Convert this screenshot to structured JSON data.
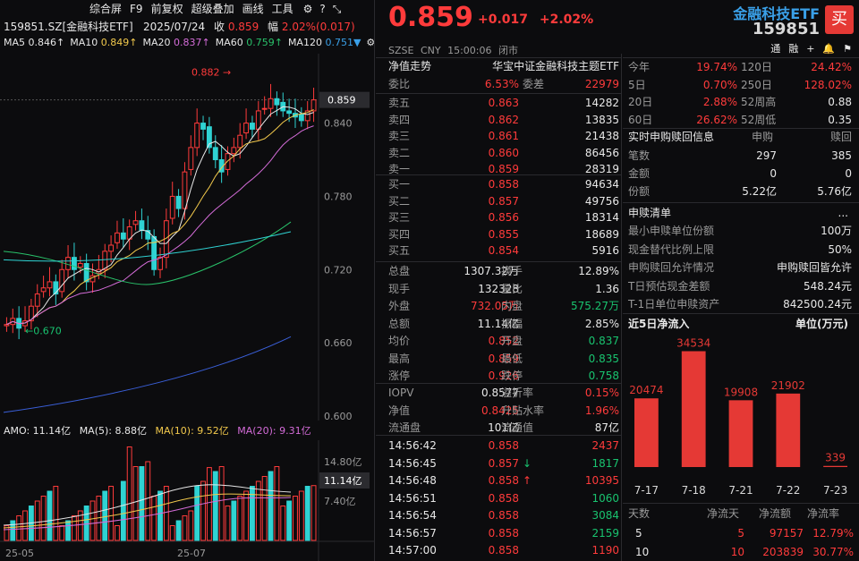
{
  "chart_header": {
    "symbol": "159851.SZ[金融科技ETF]",
    "date": "2025/07/24",
    "close_label": "收",
    "close_value": "0.859",
    "change_label": "幅",
    "change_value": "2.02%(0.017)"
  },
  "toolbar": [
    "综合屏",
    "F9",
    "前复权",
    "超级叠加",
    "画线",
    "工具"
  ],
  "ma_legend": [
    {
      "label": "MA5",
      "value": "0.846↑",
      "color": "#e8e8e8"
    },
    {
      "label": "MA10",
      "value": "0.849↑",
      "color": "#f2c94c"
    },
    {
      "label": "MA20",
      "value": "0.837↑",
      "color": "#d46cd8"
    },
    {
      "label": "MA60",
      "value": "0.759↑",
      "color": "#29c26a"
    },
    {
      "label": "MA120",
      "value": "0.751▼",
      "color": "#3aa0e8"
    }
  ],
  "price_axis": [
    "0.840",
    "0.780",
    "0.720",
    "0.660",
    "0.600"
  ],
  "current_price_tag": "0.859",
  "annotations": {
    "high": "0.882",
    "low": "0.670"
  },
  "volume_header": {
    "amo": "AMO: 11.14亿",
    "ma5": "MA(5): 8.88亿",
    "ma10": "MA(10): 9.52亿",
    "ma20": "MA(20): 9.31亿"
  },
  "volume_axis": [
    "14.80亿",
    "11.14亿",
    "7.40亿"
  ],
  "date_axis": [
    "25-05",
    "25-07"
  ],
  "quote": {
    "price": "0.859",
    "change": "+0.017",
    "change_pct": "+2.02%",
    "name": "金融科技ETF",
    "code": "159851",
    "buy_button": "买",
    "market": "SZSE",
    "currency": "CNY",
    "time": "15:00:06",
    "status": "闭市",
    "right_icons": [
      "通",
      "融",
      "+",
      "🔔",
      "⚑"
    ]
  },
  "nav": {
    "label": "净值走势",
    "fund": "华宝中证金融科技主题ETF"
  },
  "ratios": {
    "wb_label": "委比",
    "wb_value": "6.53%",
    "wc_label": "委差",
    "wc_value": "22979"
  },
  "asks": [
    {
      "label": "卖五",
      "price": "0.863",
      "vol": "14282"
    },
    {
      "label": "卖四",
      "price": "0.862",
      "vol": "13835"
    },
    {
      "label": "卖三",
      "price": "0.861",
      "vol": "21438"
    },
    {
      "label": "卖二",
      "price": "0.860",
      "vol": "86456"
    },
    {
      "label": "卖一",
      "price": "0.859",
      "vol": "28319"
    }
  ],
  "bids": [
    {
      "label": "买一",
      "price": "0.858",
      "vol": "94634"
    },
    {
      "label": "买二",
      "price": "0.857",
      "vol": "49756"
    },
    {
      "label": "买三",
      "price": "0.856",
      "vol": "18314"
    },
    {
      "label": "买四",
      "price": "0.855",
      "vol": "18689"
    },
    {
      "label": "买五",
      "price": "0.854",
      "vol": "5916"
    }
  ],
  "stats": [
    {
      "l1": "总盘",
      "v1": "1307.32万",
      "c1": "white",
      "l2": "换手",
      "v2": "12.89%",
      "c2": "white"
    },
    {
      "l1": "现手",
      "v1": "132328",
      "c1": "white",
      "l2": "量比",
      "v2": "1.36",
      "c2": "white"
    },
    {
      "l1": "外盘",
      "v1": "732.05万",
      "c1": "red",
      "l2": "内盘",
      "v2": "575.27万",
      "c2": "green"
    },
    {
      "l1": "总额",
      "v1": "11.14亿",
      "c1": "white",
      "l2": "振幅",
      "v2": "2.85%",
      "c2": "white"
    },
    {
      "l1": "均价",
      "v1": "0.852",
      "c1": "red",
      "l2": "开盘",
      "v2": "0.837",
      "c2": "green"
    },
    {
      "l1": "最高",
      "v1": "0.859",
      "c1": "red",
      "l2": "最低",
      "v2": "0.835",
      "c2": "green"
    },
    {
      "l1": "涨停",
      "v1": "0.926",
      "c1": "red",
      "l2": "跌停",
      "v2": "0.758",
      "c2": "green"
    }
  ],
  "iopv": [
    {
      "l1": "IOPV",
      "v1": "0.8577",
      "c1": "white",
      "l2": "溢折率",
      "v2": "0.15%",
      "c2": "red"
    },
    {
      "l1": "净值",
      "v1": "0.8425",
      "c1": "red",
      "l2": "升贴水率",
      "v2": "1.96%",
      "c2": "red"
    },
    {
      "l1": "流通盘",
      "v1": "101亿",
      "c1": "white",
      "l2": "流通值",
      "v2": "87亿",
      "c2": "white"
    }
  ],
  "ticks": [
    {
      "time": "14:56:42",
      "price": "0.858",
      "arrow": "",
      "vol": "2437",
      "vc": "red"
    },
    {
      "time": "14:56:45",
      "price": "0.857",
      "arrow": "↓",
      "vol": "1817",
      "vc": "green"
    },
    {
      "time": "14:56:48",
      "price": "0.858",
      "arrow": "↑",
      "vol": "10395",
      "vc": "red"
    },
    {
      "time": "14:56:51",
      "price": "0.858",
      "arrow": "",
      "vol": "1060",
      "vc": "green"
    },
    {
      "time": "14:56:54",
      "price": "0.858",
      "arrow": "",
      "vol": "3084",
      "vc": "green"
    },
    {
      "time": "14:56:57",
      "price": "0.858",
      "arrow": "",
      "vol": "2159",
      "vc": "green"
    },
    {
      "time": "14:57:00",
      "price": "0.858",
      "arrow": "",
      "vol": "1190",
      "vc": "red"
    }
  ],
  "perf": [
    {
      "l1": "今年",
      "v1": "19.74%",
      "l2": "120日",
      "v2": "24.42%",
      "c2": "red"
    },
    {
      "l1": "5日",
      "v1": "0.70%",
      "l2": "250日",
      "v2": "128.02%",
      "c2": "red"
    },
    {
      "l1": "20日",
      "v1": "2.88%",
      "l2": "52周高",
      "v2": "0.88",
      "c2": "white"
    },
    {
      "l1": "60日",
      "v1": "26.62%",
      "l2": "52周低",
      "v2": "0.35",
      "c2": "white"
    }
  ],
  "realtime": {
    "title": "实时申购赎回信息",
    "col1": "申购",
    "col2": "赎回",
    "rows": [
      {
        "label": "笔数",
        "v1": "297",
        "v2": "385"
      },
      {
        "label": "金额",
        "v1": "0",
        "v2": "0"
      },
      {
        "label": "份额",
        "v1": "5.22亿",
        "v2": "5.76亿"
      }
    ]
  },
  "purchase_list": {
    "title": "申赎清单",
    "more": "...",
    "rows": [
      {
        "label": "最小申赎单位份额",
        "value": "100万"
      },
      {
        "label": "现金替代比例上限",
        "value": "50%"
      },
      {
        "label": "申购赎回允许情况",
        "value": "申购赎回皆允许"
      },
      {
        "label": "T日预估现金差额",
        "value": "548.24元"
      },
      {
        "label": "T-1日单位申赎资产",
        "value": "842500.24元"
      }
    ]
  },
  "flow": {
    "title": "近5日净流入",
    "unit": "单位(万元)"
  },
  "flow_table": {
    "headers": [
      "天数",
      "净流天",
      "净流额",
      "净流率"
    ],
    "rows": [
      {
        "days": "5",
        "flow_days": "5",
        "amount": "97157",
        "rate": "12.79%"
      },
      {
        "days": "10",
        "flow_days": "10",
        "amount": "203839",
        "rate": "30.77%"
      }
    ]
  },
  "chart_data": [
    {
      "type": "bar",
      "title": "近5日净流入",
      "unit": "万元",
      "categories": [
        "7-17",
        "7-18",
        "7-21",
        "7-22",
        "7-23"
      ],
      "values": [
        20474,
        34534,
        19908,
        21902,
        339
      ],
      "color": "#e53935"
    },
    {
      "type": "candlestick",
      "symbol": "159851.SZ",
      "ylim": [
        0.6,
        0.88
      ],
      "closes": [
        0.675,
        0.68,
        0.672,
        0.678,
        0.69,
        0.7,
        0.705,
        0.71,
        0.7,
        0.72,
        0.73,
        0.72,
        0.725,
        0.71,
        0.715,
        0.72,
        0.735,
        0.74,
        0.75,
        0.745,
        0.755,
        0.76,
        0.752,
        0.745,
        0.72,
        0.73,
        0.76,
        0.78,
        0.77,
        0.8,
        0.82,
        0.84,
        0.835,
        0.82,
        0.81,
        0.8,
        0.815,
        0.82,
        0.83,
        0.84,
        0.835,
        0.85,
        0.852,
        0.86,
        0.855,
        0.85,
        0.848,
        0.845,
        0.842,
        0.85,
        0.859
      ],
      "ma_lines": [
        "MA5",
        "MA10",
        "MA20",
        "MA60",
        "MA120"
      ],
      "volume_unit": "亿"
    }
  ]
}
